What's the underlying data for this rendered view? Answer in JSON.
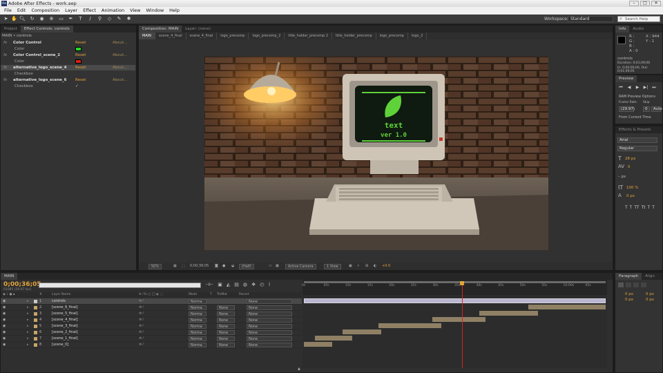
{
  "window": {
    "title": "Adobe After Effects - work.aep",
    "controls": [
      "–",
      "□",
      "✕"
    ]
  },
  "menu": [
    "File",
    "Edit",
    "Composition",
    "Layer",
    "Effect",
    "Animation",
    "View",
    "Window",
    "Help"
  ],
  "toolbar": {
    "tools": [
      "select-icon",
      "hand-icon",
      "zoom-icon",
      "rotate-icon",
      "camera-icon",
      "pan-behind-icon",
      "rectangle-icon",
      "pen-icon",
      "type-icon",
      "brush-icon",
      "clone-icon",
      "eraser-icon",
      "roto-brush-icon",
      "puppet-icon"
    ],
    "workspace_label": "Workspace:",
    "workspace_value": "Standard",
    "search_placeholder": "Search Help"
  },
  "effect_controls": {
    "tabs": [
      "Project",
      "Effect Controls: controls"
    ],
    "header": "MAIN • controls",
    "rows": [
      {
        "name": "Color Control",
        "reset": "Reset",
        "about": "About..."
      },
      {
        "sub": "Color",
        "swatch": "#22dd22"
      },
      {
        "name": "Color Control_scene_2",
        "reset": "Reset",
        "about": "About..."
      },
      {
        "sub": "Color",
        "swatch": "#dd2211"
      },
      {
        "name": "alternative_logo_scene_4",
        "reset": "Reset",
        "about": "About..."
      },
      {
        "sub": "Checkbox",
        "check": ""
      },
      {
        "name": "alternative_logo_scene_6",
        "reset": "Reset",
        "about": "About..."
      },
      {
        "sub": "Checkbox",
        "check": "✓"
      }
    ]
  },
  "composition": {
    "tabs": [
      "Composition: MAIN",
      "Layer: (none)"
    ],
    "breadcrumbs": [
      "MAIN",
      "scene_4_final",
      "scene_4_final",
      "logo_precomp",
      "logo_precomp_2",
      "title_holder_precomp 2",
      "title_holder_precomp",
      "logo_precomp",
      "logo_2"
    ],
    "screen_text": "text",
    "screen_version": "ver 1.0",
    "viewer_tools": {
      "zoom": "50%",
      "time": "0;00;36;05",
      "resolution": "(Half)",
      "camera": "Active Camera",
      "views": "1 View",
      "exposure": "+0.0"
    }
  },
  "info": {
    "tabs": [
      "Info",
      "Audio"
    ],
    "channels": [
      "R :",
      "G :",
      "B :",
      "A : 0"
    ],
    "xy": [
      "X : 944",
      "Y : 1"
    ],
    "layer": "controls",
    "duration": "Duration: 0;01;09;06",
    "inout": "In: 0;00;00;00, Out: 0;01;09;05"
  },
  "preview": {
    "title": "Preview",
    "ram": "RAM Preview Options",
    "frame_rate_label": "Frame Rate",
    "skip_label": "Skip",
    "res_label": "Resolution",
    "frame_rate": "(29.97)",
    "skip": "0",
    "res": "Auto",
    "from_current": "From Current Time"
  },
  "character": {
    "tabs": [
      "Effects & Presets",
      "Character"
    ],
    "font": "Arial",
    "style": "Regular",
    "size": "28 px",
    "leading": "Auto",
    "tracking": "0",
    "stroke": "– px",
    "vscale": "100 %",
    "hscale": "100 %",
    "baseline": "0 px",
    "tsume": "0 %",
    "styles": [
      "T",
      "T",
      "TT",
      "Tt",
      "T",
      "T"
    ]
  },
  "paragraph": {
    "tabs": [
      "Paragraph",
      "Align"
    ],
    "indent_left": "0 px",
    "indent_right": "0 px",
    "space_before": "0 px",
    "space_after": "0 px"
  },
  "timeline": {
    "tab": "MAIN",
    "time": "0;00;36;05",
    "fps": "01085 (29.97 fps)",
    "headers": {
      "name": "Layer Name",
      "mode": "Mode",
      "t": "T",
      "trkmat": "TrkMat",
      "parent": "Parent"
    },
    "ruler": [
      "0s",
      "05s",
      "10s",
      "15s",
      "20s",
      "25s",
      "30s",
      "35s",
      "40s",
      "45s",
      "50s",
      "55s",
      "01:00s",
      "05s"
    ],
    "playhead_seconds": 36.2,
    "duration_seconds": 69.2,
    "layers": [
      {
        "num": "1",
        "name": "controls",
        "mode": "Norma",
        "trkmat": "",
        "parent": "None",
        "label": "#c9c9c9",
        "start": 0,
        "end": 69.2,
        "bar": "#b9b6ce"
      },
      {
        "num": "2",
        "name": "[scene_6_final]",
        "mode": "Norma",
        "trkmat": "None",
        "parent": "None",
        "label": "#c7a56a",
        "start": 51.5,
        "end": 69.2,
        "bar": "#8f8065"
      },
      {
        "num": "3",
        "name": "[scene_5_final]",
        "mode": "Norma",
        "trkmat": "None",
        "parent": "None",
        "label": "#c7a56a",
        "start": 40.2,
        "end": 53.7,
        "bar": "#8f8065"
      },
      {
        "num": "4",
        "name": "[scene_4_final]",
        "mode": "Norma",
        "trkmat": "None",
        "parent": "None",
        "label": "#c7a56a",
        "start": 29.4,
        "end": 41.6,
        "bar": "#8f8065"
      },
      {
        "num": "5",
        "name": "[scene_3_final]",
        "mode": "Norma",
        "trkmat": "None",
        "parent": "None",
        "label": "#c7a56a",
        "start": 17.1,
        "end": 31.5,
        "bar": "#8f8065"
      },
      {
        "num": "6",
        "name": "[scene_2_final]",
        "mode": "Norma",
        "trkmat": "None",
        "parent": "None",
        "label": "#c7a56a",
        "start": 8.8,
        "end": 17.7,
        "bar": "#8f8065"
      },
      {
        "num": "7",
        "name": "[scene_1_final]",
        "mode": "Norma",
        "trkmat": "None",
        "parent": "None",
        "label": "#c7a56a",
        "start": 2.6,
        "end": 11.1,
        "bar": "#8f8065"
      },
      {
        "num": "8",
        "name": "[scene_0]",
        "mode": "Norma",
        "trkmat": "None",
        "parent": "None",
        "label": "#c7a56a",
        "start": 0,
        "end": 6.5,
        "bar": "#8f8065"
      }
    ]
  },
  "colors": {
    "accent": "#e3a43a",
    "screen_green": "#5fd23a",
    "playhead": "#e02020"
  }
}
